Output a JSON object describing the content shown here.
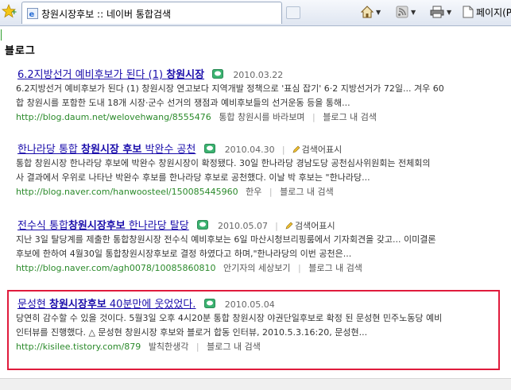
{
  "browser": {
    "tab_title": "창원시장후보 :: 네이버 통합검색",
    "page_menu_label": "페이지(P)"
  },
  "section": {
    "title": "블로그"
  },
  "results": [
    {
      "title_pre": "6.2지방선거 예비후보가 된다 (1) ",
      "title_bold": "창원시장",
      "title_post": "",
      "date": "2010.03.22",
      "tag": "",
      "desc1": "6.2지방선거 예비후보가 된다 (1) 창원시장 연고보다 지역개발 정책으로 '표심 잡기' 6·2 지방선거가 72일... 겨우 60",
      "desc2": "합 창원시를 포함한 도내 18개 시장·군수 선거의 쟁점과 예비후보들의 선거운동 등을 통해...",
      "url": "http://blog.daum.net/welovehwang/8555476",
      "blog": "통합 창원시를 바라보며",
      "in_search": "블로그 내 검색"
    },
    {
      "title_pre": "한나라당 통합 ",
      "title_bold": "창원시장 후보",
      "title_post": " 박완수 공천",
      "date": "2010.04.30",
      "tag": "검색어표시",
      "desc1": "통합 창원시장 한나라당 후보에 박완수 창원시장이 확정됐다. 30일 한나라당 경남도당 공천심사위원회는 전체회의",
      "desc2": "사 결과에서 우위로 나타난 박완수 후보를 한나라당 후보로 공천했다. 이날 박 후보는 \"한나라당...",
      "url": "http://blog.naver.com/hanwoosteel/150085445960",
      "blog": "한우",
      "in_search": "블로그 내 검색"
    },
    {
      "title_pre": "전수식 통합",
      "title_bold": "창원시장후보",
      "title_post": " 한나라당 탈당",
      "date": "2010.05.07",
      "tag": "검색어표시",
      "desc1": "지난 3일 탈당계를 제출한 통합창원시장 전수식 예비후보는 6일 마산시청브리핑룸에서 기자회견을 갖고... 이미결론",
      "desc2": "후보에 한하여 4월30일 통합창원시장후보로 결정 하였다고 하며,\"한나라당의 이번 공천은...",
      "url": "http://blog.naver.com/agh0078/10085860810",
      "blog": "안기자의 세상보기",
      "in_search": "블로그 내 검색"
    },
    {
      "title_pre": "문성현 ",
      "title_bold": "창원시장후보",
      "title_post": " 40분만에 웃었었다.",
      "date": "2010.05.04",
      "tag": "",
      "desc1": "당연히 감수할 수 있을 것이다. 5월3일 오후 4시20분 통합 창원시장 야권단일후보로 확정 된 문성현 민주노동당 예비",
      "desc2": "인터뷰를 진행했다. △ 문성현 창원시장 후보와 블로거 합동 인터뷰, 2010.5.3.16:20, 문성현...",
      "url": "http://kisilee.tistory.com/879",
      "blog": "발칙한생각",
      "in_search": "블로그 내 검색"
    }
  ],
  "colors": {
    "link": "#1a0dab",
    "url": "#2b8a2b",
    "highlight": "#e01b3c"
  }
}
